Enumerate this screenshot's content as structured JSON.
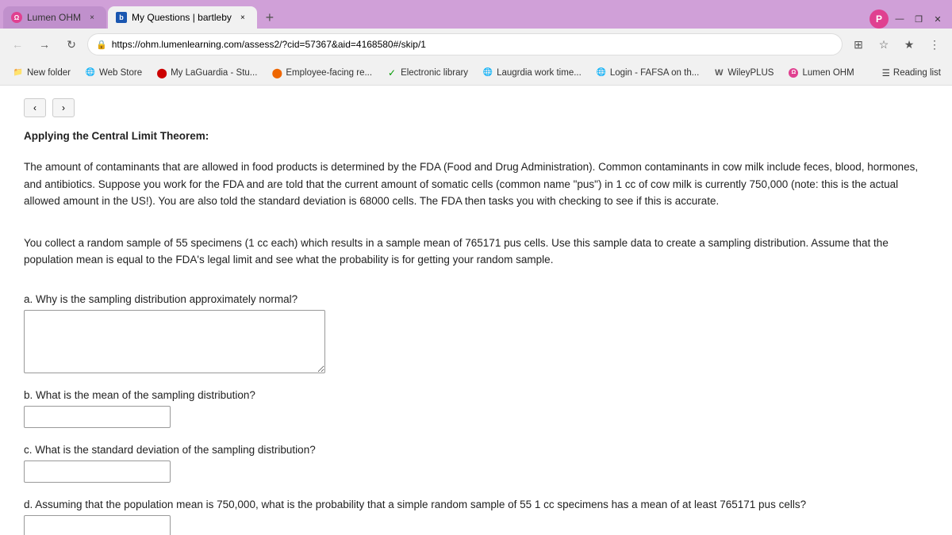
{
  "browser": {
    "tabs": [
      {
        "id": "tab-lumen",
        "favicon_type": "lumen",
        "label": "Lumen OHM",
        "active": false,
        "close_label": "×"
      },
      {
        "id": "tab-bartleby",
        "favicon_type": "bartleby",
        "label": "My Questions | bartleby",
        "active": true,
        "close_label": "×"
      }
    ],
    "new_tab_label": "+",
    "address": "https://ohm.lumenlearning.com/assess2/?cid=57367&aid=4168580#/skip/1",
    "window_controls": {
      "minimize": "—",
      "maximize": "❐",
      "close": "✕"
    }
  },
  "bookmarks": [
    {
      "id": "new-folder",
      "label": "New folder",
      "icon": "📁"
    },
    {
      "id": "web-store",
      "label": "Web Store",
      "icon": "🌐"
    },
    {
      "id": "laguardia",
      "label": "My LaGuardia - Stu...",
      "icon": "🔴"
    },
    {
      "id": "employee-facing",
      "label": "Employee-facing re...",
      "icon": "🟠"
    },
    {
      "id": "electronic-library",
      "label": "Electronic library",
      "icon": "✓"
    },
    {
      "id": "laugrdia-work",
      "label": "Laugrdia work time...",
      "icon": "🟡"
    },
    {
      "id": "login-fafsa",
      "label": "Login - FAFSA on th...",
      "icon": "🌐"
    },
    {
      "id": "wileyplus",
      "label": "WileyPLUS",
      "icon": "W"
    },
    {
      "id": "lumen-ohm-bm",
      "label": "Lumen OHM",
      "icon": "Ω"
    }
  ],
  "reading_list": {
    "label": "Reading list",
    "icon": "≡"
  },
  "page": {
    "heading": "Applying the Central Limit Theorem:",
    "intro": "The amount of contaminants that are allowed in food products is determined by the FDA (Food and Drug Administration). Common contaminants in cow milk include feces, blood, hormones, and antibiotics. Suppose you work for the FDA and are told that the current amount of somatic cells (common name \"pus\") in 1 cc of cow milk is currently 750,000 (note: this is the actual allowed amount in the US!). You are also told the standard deviation is 68000 cells. The FDA then tasks you with checking to see if this is accurate.",
    "para2": "You collect a random sample of 55 specimens (1 cc each)  which results in a sample mean of 765171 pus cells. Use this sample data to create a sampling distribution. Assume that the population mean is equal to the FDA's legal limit and see what the probability is for getting your random sample.",
    "parts": [
      {
        "id": "part-a",
        "label": "a. Why is the sampling distribution approximately normal?",
        "type": "textarea",
        "placeholder": ""
      },
      {
        "id": "part-b",
        "label": "b. What is the mean of the sampling distribution?",
        "type": "input",
        "placeholder": ""
      },
      {
        "id": "part-c",
        "label": "c. What is the standard deviation of the sampling distribution?",
        "type": "input",
        "placeholder": ""
      },
      {
        "id": "part-d",
        "label": "d. Assuming that the population mean is 750,000, what is the probability that a simple random sample of 55 1 cc specimens has a mean of at least 765171 pus cells?",
        "type": "input",
        "placeholder": ""
      }
    ]
  }
}
